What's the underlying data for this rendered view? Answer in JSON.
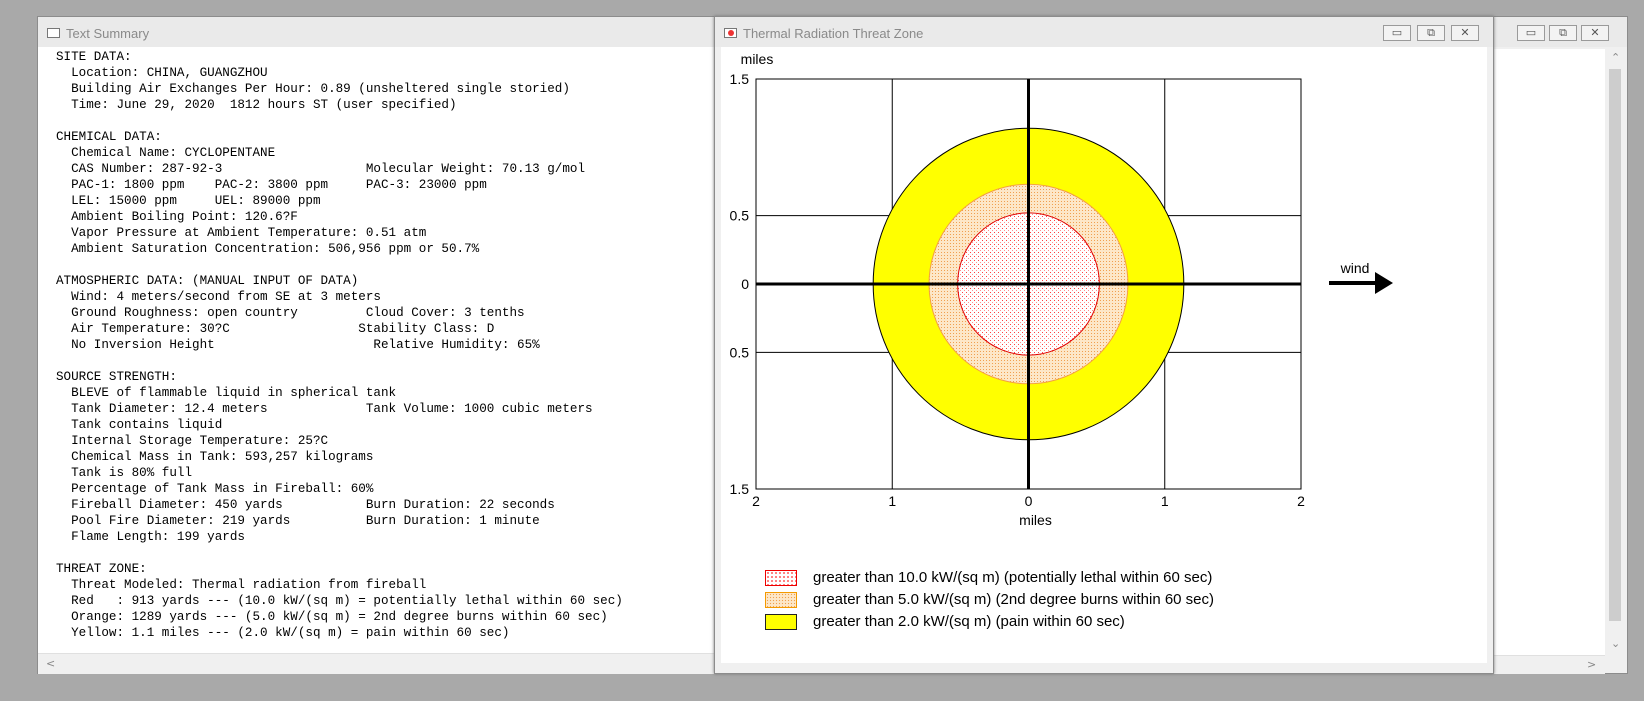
{
  "text_summary": {
    "title": "Text Summary",
    "lines": [
      "SITE DATA:",
      "  Location: CHINA, GUANGZHOU",
      "  Building Air Exchanges Per Hour: 0.89 (unsheltered single storied)",
      "  Time: June 29, 2020  1812 hours ST (user specified)",
      "",
      "CHEMICAL DATA:",
      "  Chemical Name: CYCLOPENTANE",
      "  CAS Number: 287-92-3                   Molecular Weight: 70.13 g/mol",
      "  PAC-1: 1800 ppm    PAC-2: 3800 ppm     PAC-3: 23000 ppm",
      "  LEL: 15000 ppm     UEL: 89000 ppm",
      "  Ambient Boiling Point: 120.6?F",
      "  Vapor Pressure at Ambient Temperature: 0.51 atm",
      "  Ambient Saturation Concentration: 506,956 ppm or 50.7%",
      "",
      "ATMOSPHERIC DATA: (MANUAL INPUT OF DATA)",
      "  Wind: 4 meters/second from SE at 3 meters",
      "  Ground Roughness: open country         Cloud Cover: 3 tenths",
      "  Air Temperature: 30?C                 Stability Class: D",
      "  No Inversion Height                     Relative Humidity: 65%",
      "",
      "SOURCE STRENGTH:",
      "  BLEVE of flammable liquid in spherical tank",
      "  Tank Diameter: 12.4 meters             Tank Volume: 1000 cubic meters",
      "  Tank contains liquid",
      "  Internal Storage Temperature: 25?C",
      "  Chemical Mass in Tank: 593,257 kilograms",
      "  Tank is 80% full",
      "  Percentage of Tank Mass in Fireball: 60%",
      "  Fireball Diameter: 450 yards           Burn Duration: 22 seconds",
      "  Pool Fire Diameter: 219 yards          Burn Duration: 1 minute",
      "  Flame Length: 199 yards",
      "",
      "THREAT ZONE:",
      "  Threat Modeled: Thermal radiation from fireball",
      "  Red   : 913 yards --- (10.0 kW/(sq m) = potentially lethal within 60 sec)",
      "  Orange: 1289 yards --- (5.0 kW/(sq m) = 2nd degree burns within 60 sec)",
      "  Yellow: 1.1 miles --- (2.0 kW/(sq m) = pain within 60 sec)"
    ]
  },
  "threat_window": {
    "title": "Thermal Radiation Threat Zone",
    "y_unit": "miles",
    "x_unit": "miles",
    "y_ticks": [
      "1.5",
      "0.5",
      "0",
      "0.5",
      "1.5"
    ],
    "x_ticks": [
      "2",
      "1",
      "0",
      "1",
      "2"
    ],
    "wind_label": "wind",
    "legend": [
      {
        "label": "greater than 10.0 kW/(sq m) (potentially lethal within 60 sec)",
        "color": "#ff0000",
        "fill": "dotted-red"
      },
      {
        "label": "greater than 5.0 kW/(sq m) (2nd degree burns within 60 sec)",
        "color": "#ff9a00",
        "fill": "dotted-orange"
      },
      {
        "label": "greater than 2.0 kW/(sq m) (pain within 60 sec)",
        "color": "#ffff00",
        "fill": "solid-yellow"
      }
    ]
  },
  "chart_data": {
    "type": "scatter",
    "title": "",
    "xlabel": "miles",
    "ylabel": "miles",
    "xlim": [
      -2,
      2
    ],
    "ylim": [
      -1.5,
      1.5
    ],
    "grid": true,
    "zones": [
      {
        "name": "greater than 2.0 kW/(sq m) (pain within 60 sec)",
        "radius_miles": 1.14,
        "color": "#ffff00"
      },
      {
        "name": "greater than 5.0 kW/(sq m) (2nd degree burns within 60 sec)",
        "radius_miles": 0.73,
        "color": "#ff9a00"
      },
      {
        "name": "greater than 10.0 kW/(sq m) (potentially lethal within 60 sec)",
        "radius_miles": 0.52,
        "color": "#ff0000"
      }
    ],
    "wind_direction": "east"
  },
  "window_buttons": {
    "minimize": "▭",
    "restore": "⧉",
    "close": "✕"
  }
}
